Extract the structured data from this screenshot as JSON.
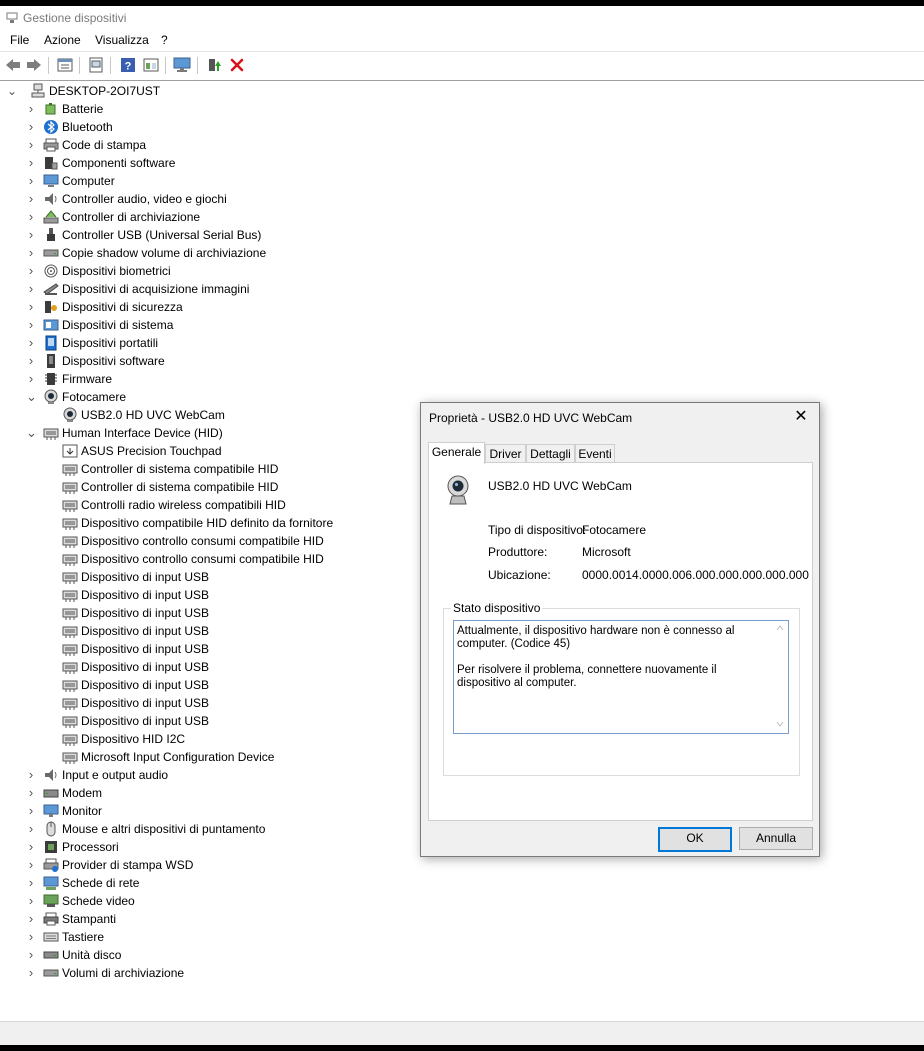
{
  "window": {
    "title": "Gestione dispositivi"
  },
  "menu": {
    "items": [
      "File",
      "Azione",
      "Visualizza",
      "?"
    ]
  },
  "toolbar": {
    "icons": [
      "back-arrow-icon",
      "forward-arrow-icon",
      "properties-view-icon",
      "console-icon",
      "help-icon",
      "window-icon",
      "monitor-scan-icon",
      "add-driver-icon",
      "uninstall-x-icon"
    ]
  },
  "tree": {
    "root": "DESKTOP-2OI7UST",
    "items": [
      {
        "label": "Batterie",
        "level": 1,
        "expand": ">",
        "icon": "battery-icon"
      },
      {
        "label": "Bluetooth",
        "level": 1,
        "expand": ">",
        "icon": "bluetooth-icon"
      },
      {
        "label": "Code di stampa",
        "level": 1,
        "expand": ">",
        "icon": "print-queue-icon"
      },
      {
        "label": "Componenti software",
        "level": 1,
        "expand": ">",
        "icon": "software-component-icon"
      },
      {
        "label": "Computer",
        "level": 1,
        "expand": ">",
        "icon": "computer-icon"
      },
      {
        "label": "Controller audio, video e giochi",
        "level": 1,
        "expand": ">",
        "icon": "speaker-icon"
      },
      {
        "label": "Controller di archiviazione",
        "level": 1,
        "expand": ">",
        "icon": "storage-controller-icon"
      },
      {
        "label": "Controller USB (Universal Serial Bus)",
        "level": 1,
        "expand": ">",
        "icon": "usb-icon"
      },
      {
        "label": "Copie shadow volume di archiviazione",
        "level": 1,
        "expand": ">",
        "icon": "drive-icon"
      },
      {
        "label": "Dispositivi biometrici",
        "level": 1,
        "expand": ">",
        "icon": "fingerprint-icon"
      },
      {
        "label": "Dispositivi di acquisizione immagini",
        "level": 1,
        "expand": ">",
        "icon": "scanner-icon"
      },
      {
        "label": "Dispositivi di sicurezza",
        "level": 1,
        "expand": ">",
        "icon": "security-key-icon"
      },
      {
        "label": "Dispositivi di sistema",
        "level": 1,
        "expand": ">",
        "icon": "system-device-icon"
      },
      {
        "label": "Dispositivi portatili",
        "level": 1,
        "expand": ">",
        "icon": "portable-device-icon"
      },
      {
        "label": "Dispositivi software",
        "level": 1,
        "expand": ">",
        "icon": "software-device-icon"
      },
      {
        "label": "Firmware",
        "level": 1,
        "expand": ">",
        "icon": "chip-icon"
      },
      {
        "label": "Fotocamere",
        "level": 1,
        "expand": "v",
        "icon": "webcam-icon"
      },
      {
        "label": "USB2.0 HD UVC WebCam",
        "level": 2,
        "expand": "",
        "icon": "webcam-icon"
      },
      {
        "label": "Human Interface Device (HID)",
        "level": 1,
        "expand": "v",
        "icon": "hid-icon"
      },
      {
        "label": "ASUS Precision Touchpad",
        "level": 2,
        "expand": "",
        "icon": "touchpad-icon"
      },
      {
        "label": "Controller di sistema compatibile HID",
        "level": 2,
        "expand": "",
        "icon": "hid-icon"
      },
      {
        "label": "Controller di sistema compatibile HID",
        "level": 2,
        "expand": "",
        "icon": "hid-icon"
      },
      {
        "label": "Controlli radio wireless compatibili HID",
        "level": 2,
        "expand": "",
        "icon": "hid-icon"
      },
      {
        "label": "Dispositivo compatibile HID definito da fornitore",
        "level": 2,
        "expand": "",
        "icon": "hid-icon"
      },
      {
        "label": "Dispositivo controllo consumi compatibile HID",
        "level": 2,
        "expand": "",
        "icon": "hid-icon"
      },
      {
        "label": "Dispositivo controllo consumi compatibile HID",
        "level": 2,
        "expand": "",
        "icon": "hid-icon"
      },
      {
        "label": "Dispositivo di input USB",
        "level": 2,
        "expand": "",
        "icon": "hid-icon"
      },
      {
        "label": "Dispositivo di input USB",
        "level": 2,
        "expand": "",
        "icon": "hid-icon"
      },
      {
        "label": "Dispositivo di input USB",
        "level": 2,
        "expand": "",
        "icon": "hid-icon"
      },
      {
        "label": "Dispositivo di input USB",
        "level": 2,
        "expand": "",
        "icon": "hid-icon"
      },
      {
        "label": "Dispositivo di input USB",
        "level": 2,
        "expand": "",
        "icon": "hid-icon"
      },
      {
        "label": "Dispositivo di input USB",
        "level": 2,
        "expand": "",
        "icon": "hid-icon"
      },
      {
        "label": "Dispositivo di input USB",
        "level": 2,
        "expand": "",
        "icon": "hid-icon"
      },
      {
        "label": "Dispositivo di input USB",
        "level": 2,
        "expand": "",
        "icon": "hid-icon"
      },
      {
        "label": "Dispositivo di input USB",
        "level": 2,
        "expand": "",
        "icon": "hid-icon"
      },
      {
        "label": "Dispositivo HID I2C",
        "level": 2,
        "expand": "",
        "icon": "hid-icon"
      },
      {
        "label": "Microsoft Input Configuration Device",
        "level": 2,
        "expand": "",
        "icon": "hid-icon"
      },
      {
        "label": "Input e output audio",
        "level": 1,
        "expand": ">",
        "icon": "speaker-icon"
      },
      {
        "label": "Modem",
        "level": 1,
        "expand": ">",
        "icon": "modem-icon"
      },
      {
        "label": "Monitor",
        "level": 1,
        "expand": ">",
        "icon": "monitor-icon"
      },
      {
        "label": "Mouse e altri dispositivi di puntamento",
        "level": 1,
        "expand": ">",
        "icon": "mouse-icon"
      },
      {
        "label": "Processori",
        "level": 1,
        "expand": ">",
        "icon": "processor-icon"
      },
      {
        "label": "Provider di stampa WSD",
        "level": 1,
        "expand": ">",
        "icon": "printer-network-icon"
      },
      {
        "label": "Schede di rete",
        "level": 1,
        "expand": ">",
        "icon": "network-adapter-icon"
      },
      {
        "label": "Schede video",
        "level": 1,
        "expand": ">",
        "icon": "display-adapter-icon"
      },
      {
        "label": "Stampanti",
        "level": 1,
        "expand": ">",
        "icon": "printer-icon"
      },
      {
        "label": "Tastiere",
        "level": 1,
        "expand": ">",
        "icon": "keyboard-icon"
      },
      {
        "label": "Unità disco",
        "level": 1,
        "expand": ">",
        "icon": "disk-drive-icon"
      },
      {
        "label": "Volumi di archiviazione",
        "level": 1,
        "expand": ">",
        "icon": "drive-icon"
      }
    ]
  },
  "dialog": {
    "title": "Proprietà - USB2.0 HD UVC WebCam",
    "close": "✕",
    "tabs": [
      "Generale",
      "Driver",
      "Dettagli",
      "Eventi"
    ],
    "active_tab": "Generale",
    "device_name": "USB2.0 HD UVC WebCam",
    "properties": [
      {
        "label": "Tipo di dispositivo:",
        "value": "Fotocamere"
      },
      {
        "label": "Produttore:",
        "value": "Microsoft"
      },
      {
        "label": "Ubicazione:",
        "value": "0000.0014.0000.006.000.000.000.000.000"
      }
    ],
    "status_group_title": "Stato dispositivo",
    "status_text": "Attualmente, il dispositivo hardware non è connesso al computer. (Codice 45)\n\nPer risolvere il problema, connettere nuovamente il dispositivo al computer.",
    "ok_label": "OK",
    "cancel_label": "Annulla"
  },
  "colors": {
    "accent": "#0078d7",
    "status_border": "#7a9cc8",
    "dialog_bg": "#f0f0f0"
  }
}
